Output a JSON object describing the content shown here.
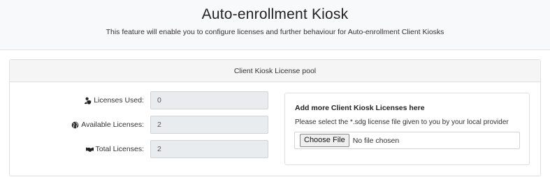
{
  "header": {
    "title": "Auto-enrollment Kiosk",
    "subtitle": "This feature will enable you to configure licenses and further behaviour for Auto-enrollment Client Kiosks"
  },
  "card": {
    "title": "Client Kiosk License pool",
    "fields": [
      {
        "icon": "user-shield-icon",
        "label": "Licenses Used:",
        "value": "0"
      },
      {
        "icon": "globe-icon",
        "label": "Available Licenses:",
        "value": "2"
      },
      {
        "icon": "handshake-icon",
        "label": "Total Licenses:",
        "value": "2"
      }
    ]
  },
  "add_panel": {
    "title": "Add more Client Kiosk Licenses here",
    "description": "Please select the *.sdg license file given to you by your local provider",
    "choose_button": "Choose File",
    "file_status": "No file chosen"
  }
}
